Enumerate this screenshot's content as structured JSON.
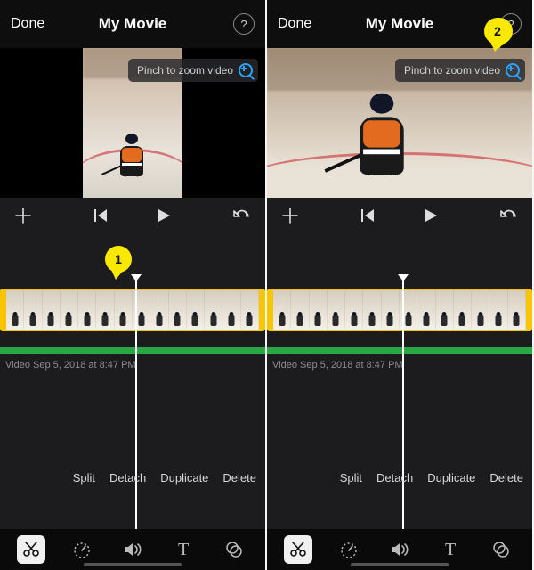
{
  "header": {
    "done": "Done",
    "title": "My Movie",
    "help": "?"
  },
  "preview": {
    "zoom_hint": "Pinch to zoom video"
  },
  "transport": {
    "add": "＋",
    "prev": "|◀",
    "play": "▶",
    "undo": "↶"
  },
  "timeline": {
    "meta": "Video Sep 5, 2018 at 8:47 PM"
  },
  "clip_actions": {
    "split": "Split",
    "detach": "Detach",
    "duplicate": "Duplicate",
    "delete": "Delete"
  },
  "toolbar": {
    "scissors": "scissors",
    "speed": "speed",
    "volume": "volume",
    "text": "T",
    "filters": "filters"
  },
  "callouts": {
    "one": "1",
    "two": "2"
  }
}
